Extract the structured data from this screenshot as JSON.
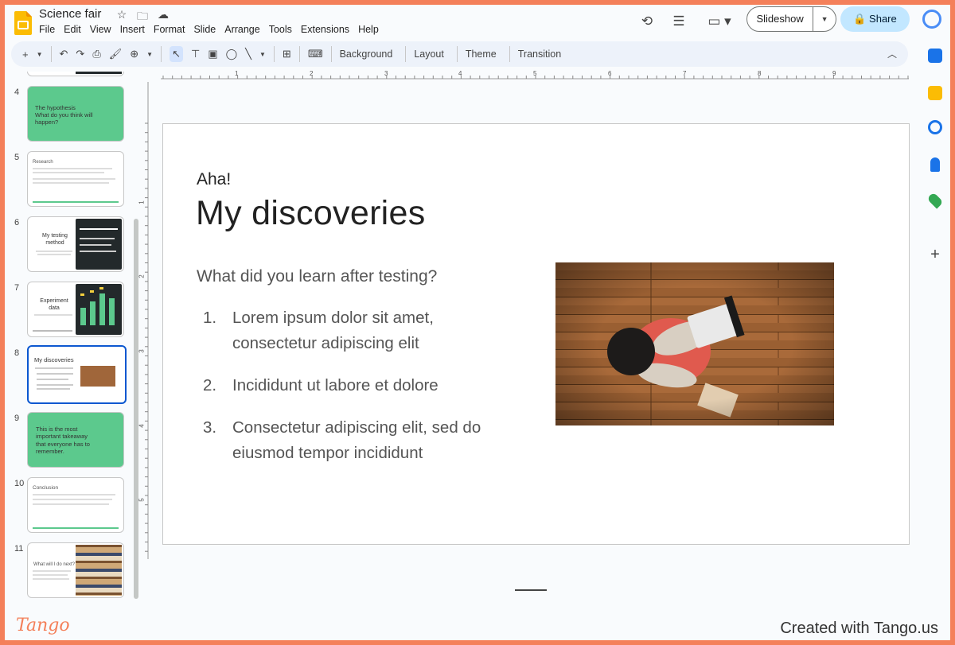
{
  "app": {
    "doc_title": "Science fair"
  },
  "menu": [
    "File",
    "Edit",
    "View",
    "Insert",
    "Format",
    "Slide",
    "Arrange",
    "Tools",
    "Extensions",
    "Help"
  ],
  "header": {
    "slideshow_label": "Slideshow",
    "share_label": "Share"
  },
  "toolbar": {
    "background_label": "Background",
    "layout_label": "Layout",
    "theme_label": "Theme",
    "transition_label": "Transition"
  },
  "ruler": {
    "h": [
      "1",
      "2",
      "3",
      "4",
      "5",
      "6",
      "7",
      "8",
      "9"
    ],
    "v": [
      "1",
      "2",
      "3",
      "4",
      "5"
    ]
  },
  "filmstrip": {
    "slides": [
      {
        "num": "4",
        "line1": "The hypothesis",
        "line2": "What do you think will happen?"
      },
      {
        "num": "5",
        "line1": "Research"
      },
      {
        "num": "6",
        "line1": "My testing method"
      },
      {
        "num": "7",
        "line1": "Experiment data"
      },
      {
        "num": "8",
        "line1": "My discoveries"
      },
      {
        "num": "9",
        "line1": "This is the most important takeaway that everyone has to remember."
      },
      {
        "num": "10",
        "line1": "Conclusion"
      },
      {
        "num": "11",
        "line1": "What will I do next?"
      }
    ]
  },
  "slide": {
    "kicker": "Aha!",
    "title": "My discoveries",
    "question": "What did you learn after testing?",
    "items": [
      {
        "num": "1.",
        "text": "Lorem ipsum dolor sit amet, consectetur adipiscing elit"
      },
      {
        "num": "2.",
        "text": "Incididunt ut labore et dolore"
      },
      {
        "num": "3.",
        "text": "Consectetur adipiscing elit, sed do eiusmod tempor incididunt"
      }
    ]
  },
  "footer": {
    "logo": "Tango",
    "credit": "Created with Tango.us"
  },
  "colors": {
    "accent_green": "#5cc98d",
    "active_blue": "#0b57d0",
    "share_bg": "#c2e7ff",
    "frame": "#f4805a"
  }
}
